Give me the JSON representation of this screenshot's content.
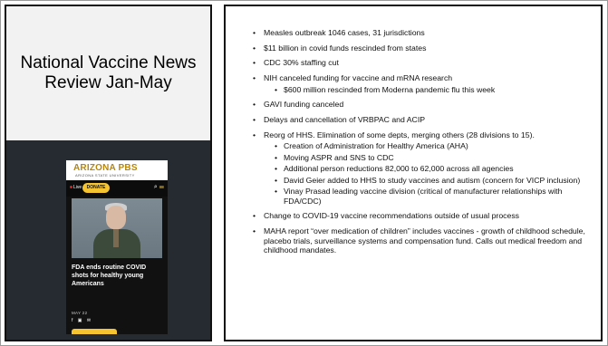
{
  "slide": {
    "title_lines": [
      "National Vaccine News",
      "Review Jan-May"
    ]
  },
  "screenshot": {
    "logo": "ARIZONA PBS",
    "logo_sub": "ARIZONA STATE UNIVERSITY",
    "live_label": "Live",
    "donate_label": "DONATE",
    "headline": "FDA ends routine COVID shots for healthy young Americans",
    "date": "MAY 22",
    "icons": [
      "search-icon",
      "menu-icon",
      "facebook-icon",
      "linkedin-icon",
      "email-icon"
    ]
  },
  "bullets": [
    {
      "text": "Measles outbreak 1046 cases, 31 jurisdictions"
    },
    {
      "text": "$11 billion in covid funds rescinded from states"
    },
    {
      "text": "CDC 30% staffing cut"
    },
    {
      "text": "NIH canceled funding for vaccine and mRNA research",
      "sub": [
        "$600 million rescinded from Moderna pandemic flu this week"
      ]
    },
    {
      "text": "GAVI funding canceled"
    },
    {
      "text": "Delays and cancellation of VRBPAC and ACIP"
    },
    {
      "text": "Reorg of HHS. Elimination of some depts, merging others (28 divisions to 15).",
      "sub": [
        "Creation of Administration for Healthy America (AHA)",
        "Moving ASPR and SNS to CDC",
        "Additional person reductions 82,000 to 62,000 across all agencies",
        "David Geier added to HHS to study vaccines and autism (concern for VICP inclusion)",
        "Vinay Prasad leading vaccine division (critical of manufacturer relationships with FDA/CDC)"
      ]
    },
    {
      "text": "Change to COVID-19 vaccine recommendations outside of usual process"
    },
    {
      "text": "MAHA report “over medication of children” includes vaccines - growth of childhood schedule, placebo trials, surveillance systems and compensation fund. Calls out medical freedom and childhood mandates."
    }
  ]
}
